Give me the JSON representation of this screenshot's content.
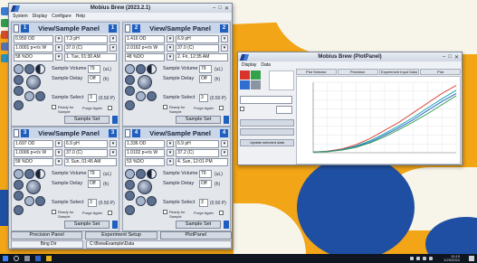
{
  "app": {
    "title": "Mobius Brew (2023.2.1)",
    "window_controls": [
      "–",
      "□",
      "✕"
    ],
    "menu": [
      "System",
      "Display",
      "Configure",
      "Help"
    ]
  },
  "panels": [
    {
      "title": "View/Sample Panel",
      "number": "1",
      "fields": [
        "0.950 OD",
        "7.3 pH",
        "1.0001 p+r/s W",
        "37.0 (C)",
        "58 %DO",
        "1.  Tue, 01:30 AM"
      ],
      "volume_label": "Sample Volume",
      "volume_value": "79",
      "volume_unit": "(uL)",
      "delay_label": "Sample Delay",
      "delay_value": "Off",
      "delay_unit": "(h)",
      "select_label": "Sample Select",
      "select_value": "3",
      "select_unit": "(0.50 P)",
      "ready_label": "Ready for Sample",
      "purge_label": "Purge Again",
      "set_label": "Sample Set"
    },
    {
      "title": "View/Sample Panel",
      "number": "2",
      "fields": [
        "1.416 OD",
        "6.9 pH",
        "2.0162 p+r/s W",
        "37.0 (C)",
        "48 %DO",
        "2.  Fri, 12:35 AM"
      ],
      "volume_label": "Sample Volume",
      "volume_value": "79",
      "volume_unit": "(uL)",
      "delay_label": "Sample Delay",
      "delay_value": "Off",
      "delay_unit": "(h)",
      "select_label": "Sample Select",
      "select_value": "3",
      "select_unit": "(0.50 P)",
      "ready_label": "Ready for Sample",
      "purge_label": "Purge Again",
      "set_label": "Sample Set"
    },
    {
      "title": "View/Sample Panel",
      "number": "3",
      "fields": [
        "1.697 OD",
        "6.9 pH",
        "1.0006 p+r/s W",
        "37.0 (C)",
        "58 %DO",
        "3.  Sun, 01:45 AM"
      ],
      "volume_label": "Sample Volume",
      "volume_value": "79",
      "volume_unit": "(uL)",
      "delay_label": "Sample Delay",
      "delay_value": "Off",
      "delay_unit": "(h)",
      "select_label": "Sample Select",
      "select_value": "3",
      "select_unit": "(0.50 P)",
      "ready_label": "Ready for Sample",
      "purge_label": "Purge Again",
      "set_label": "Sample Set"
    },
    {
      "title": "View/Sample Panel",
      "number": "4",
      "fields": [
        "1.336 OD",
        "6.9 pH",
        "1.0102 p+r/s W",
        "37.2 (C)",
        "53 %DO",
        "4.  Sun, 12:01 PM"
      ],
      "volume_label": "Sample Volume",
      "volume_value": "79",
      "volume_unit": "(uL)",
      "delay_label": "Sample Delay",
      "delay_value": "Off",
      "delay_unit": "(h)",
      "select_label": "Sample Select",
      "select_value": "3",
      "select_unit": "(0.50 P)",
      "ready_label": "Ready for Sample",
      "purge_label": "Purge Again",
      "set_label": "Sample Set"
    }
  ],
  "bottom_buttons": [
    "Precision Panel",
    "Experiment Setup",
    "PlotPanel"
  ],
  "status": {
    "left": "Bing Dir",
    "path": "C:\\BrewExample\\Data"
  },
  "plot_window": {
    "title": "Mobius Brew (PlotPanel)",
    "menu": [
      "Display",
      "Data"
    ],
    "tabs": [
      "Plot Selector",
      "Precision",
      "Experiment Input Data",
      "Plot"
    ],
    "left_buttons": [
      "Update selected data"
    ],
    "colors": {
      "swatch_red": "#d9342b",
      "swatch_green": "#33a34a",
      "swatch_blue": "#2f6fd1",
      "swatch_gray": "#8b94a3",
      "line_red": "#e04a3c",
      "line_teal": "#1aa7b3",
      "line_blue": "#2e64c8",
      "line_green": "#3aa55a"
    }
  },
  "chart_data": {
    "type": "line",
    "series": [
      {
        "values": [
          0.02,
          0.05,
          0.12,
          0.25,
          0.45,
          0.7,
          0.95,
          1.25,
          1.55,
          1.85,
          2.1
        ]
      },
      {
        "values": [
          0.02,
          0.04,
          0.1,
          0.21,
          0.38,
          0.6,
          0.84,
          1.1,
          1.4,
          1.68,
          1.95
        ]
      },
      {
        "values": [
          0.02,
          0.04,
          0.09,
          0.19,
          0.34,
          0.55,
          0.78,
          1.03,
          1.32,
          1.6,
          1.85
        ]
      },
      {
        "values": [
          0.02,
          0.03,
          0.08,
          0.17,
          0.31,
          0.5,
          0.72,
          0.96,
          1.22,
          1.5,
          1.78
        ]
      }
    ],
    "x": [
      0,
      1,
      2,
      3,
      4,
      5,
      6,
      7,
      8,
      9,
      10
    ],
    "ylim": [
      0,
      2.2
    ],
    "grid": true
  },
  "taskbar": {
    "time": "10:19",
    "date": "1/29/2024"
  }
}
